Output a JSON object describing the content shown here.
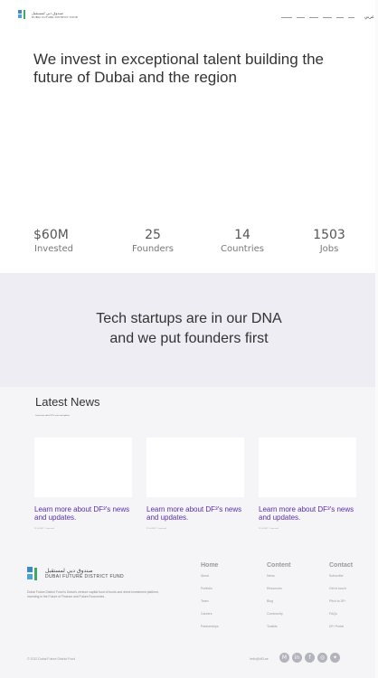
{
  "header": {
    "logo_ar": "صندوق دبي لمستقبل",
    "logo_en": "DUBAI FUTURE DISTRICT FUND",
    "lang": "عربي"
  },
  "hero": {
    "title": "We invest in exceptional talent building the future of Dubai and the region",
    "stats": [
      {
        "value": "$60M",
        "label": "Invested"
      },
      {
        "value": "25",
        "label": "Founders"
      },
      {
        "value": "14",
        "label": "Countries"
      },
      {
        "value": "1503",
        "label": "Jobs"
      }
    ]
  },
  "tagline": {
    "line1": "Tech startups are in our DNA",
    "line2": "and we put founders first"
  },
  "news": {
    "title": "Latest News",
    "subtitle": "Learn more about DF³'s news and updates",
    "cards": [
      {
        "title": "Learn more about DF³'s news and updates.",
        "meta": "22 Jul 2022 · 2 min read"
      },
      {
        "title": "Learn more about DF³'s news and updates.",
        "meta": "22 Jul 2022 · 2 min read"
      },
      {
        "title": "Learn more about DF³'s news and updates.",
        "meta": "22 Jul 2022 · 2 min read"
      }
    ]
  },
  "footer": {
    "logo_ar": "صندوق دبي لمستقبل",
    "logo_en": "DUBAI FUTURE DISTRICT FUND",
    "description": "Dubai Future District Fund is Dubai's venture capital fund of funds and direct investment platform, investing in the Future of Finance and Future Economies.",
    "columns": [
      {
        "title": "Home",
        "links": [
          "About",
          "Portfolio",
          "Team",
          "Careers",
          "Partnerships"
        ]
      },
      {
        "title": "Content",
        "links": [
          "News",
          "Resources",
          "Blog",
          "Community",
          "Toolkits"
        ]
      },
      {
        "title": "Contact",
        "links": [
          "Subscribe",
          "Get in touch",
          "Pitch to DF³",
          "FAQs",
          "DF³ Portal"
        ]
      }
    ],
    "copyright": "© 2022 Dubai Future District Fund",
    "email": "hello@df3.ae",
    "social": [
      "medium-icon",
      "linkedin-icon",
      "facebook-icon",
      "instagram-icon",
      "twitter-icon"
    ]
  }
}
